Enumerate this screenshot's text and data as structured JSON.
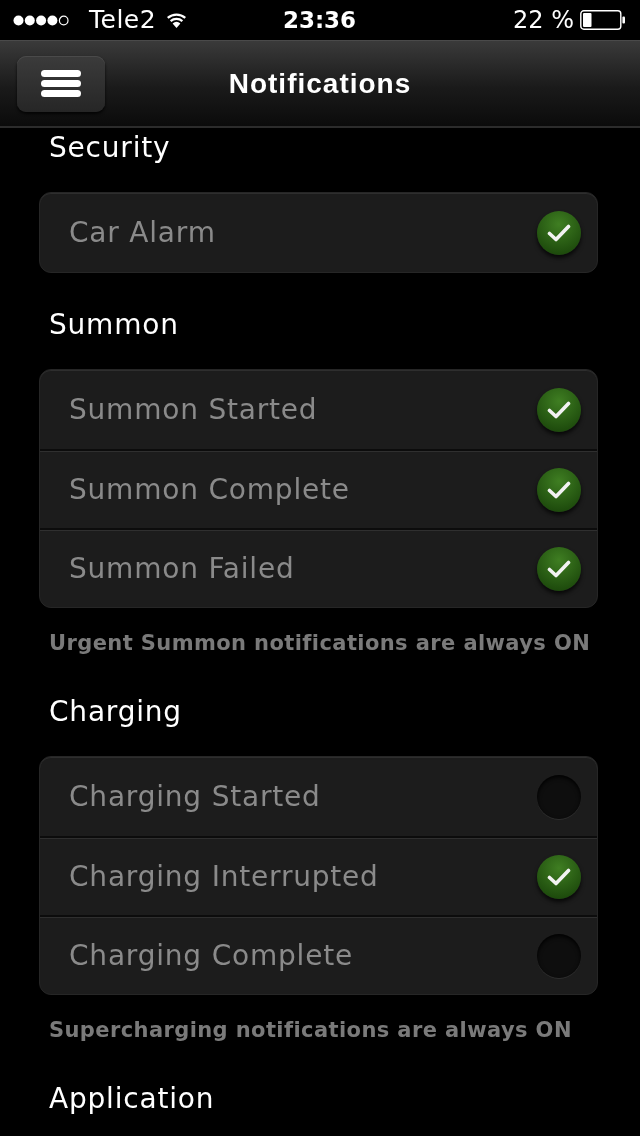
{
  "status_bar": {
    "carrier": "Tele2",
    "time": "23:36",
    "battery_percent": "22 %"
  },
  "nav_bar": {
    "title": "Notifications"
  },
  "sections": [
    {
      "heading": "Security",
      "items": [
        {
          "label": "Car Alarm",
          "checked": true
        }
      ]
    },
    {
      "heading": "Summon",
      "items": [
        {
          "label": "Summon Started",
          "checked": true
        },
        {
          "label": "Summon Complete",
          "checked": true
        },
        {
          "label": "Summon Failed",
          "checked": true
        }
      ],
      "footnote": "Urgent Summon notifications are always ON"
    },
    {
      "heading": "Charging",
      "items": [
        {
          "label": "Charging Started",
          "checked": false
        },
        {
          "label": "Charging Interrupted",
          "checked": true
        },
        {
          "label": "Charging Complete",
          "checked": false
        }
      ],
      "footnote": "Supercharging notifications are always ON"
    },
    {
      "heading": "Application"
    }
  ]
}
